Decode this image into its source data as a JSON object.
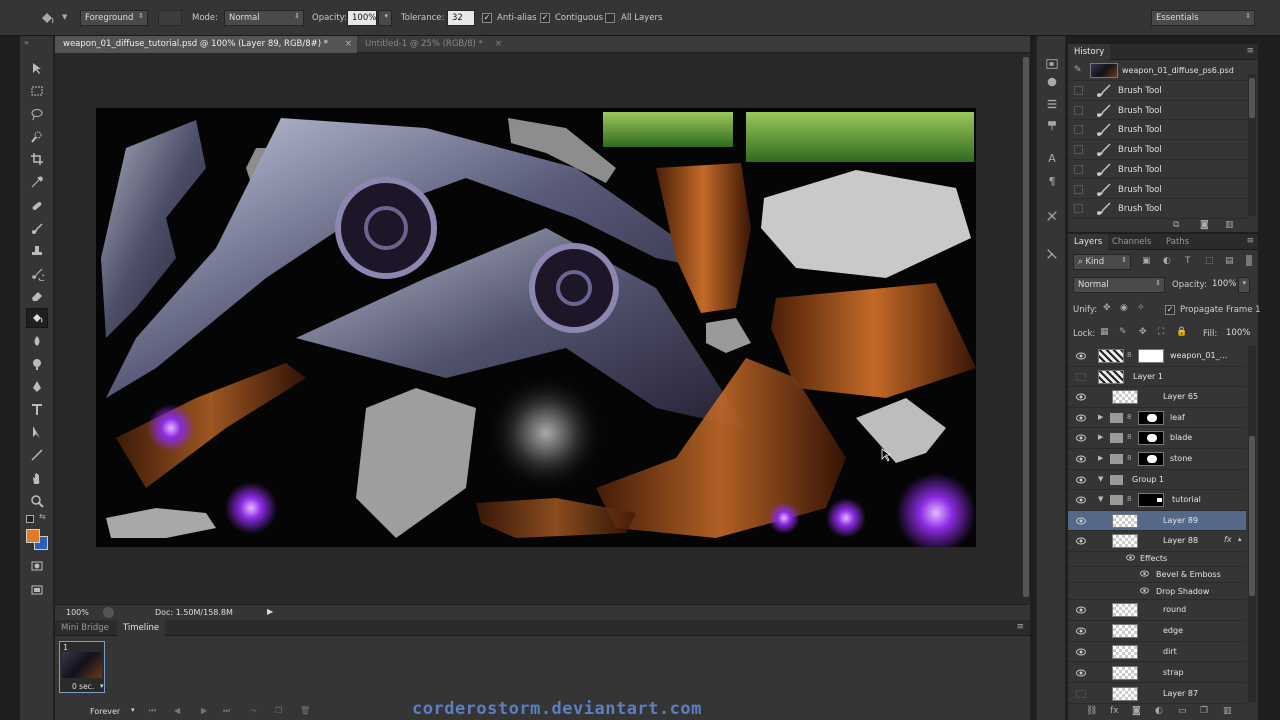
{
  "options_bar": {
    "preset": "Foreground",
    "mode_label": "Mode:",
    "mode_value": "Normal",
    "opacity_label": "Opacity:",
    "opacity_value": "100%",
    "tolerance_label": "Tolerance:",
    "tolerance_value": "32",
    "anti_alias_label": "Anti-alias",
    "contiguous_label": "Contiguous",
    "all_layers_label": "All Layers",
    "workspace": "Essentials"
  },
  "doc_tabs": [
    {
      "label": "weapon_01_diffuse_tutorial.psd @ 100% (Layer 89, RGB/8#) *"
    },
    {
      "label": "Untitled-1 @ 25% (RGB/8) *"
    }
  ],
  "status": {
    "zoom": "100%",
    "doc_size": "Doc: 1.50M/158.8M"
  },
  "bottom_panel": {
    "tabs": [
      "Mini Bridge",
      "Timeline"
    ],
    "frame_number": "1",
    "frame_delay": "0 sec.",
    "loop": "Forever"
  },
  "history": {
    "title": "History",
    "snapshot": "weapon_01_diffuse_ps6.psd",
    "items": [
      "Brush Tool",
      "Brush Tool",
      "Brush Tool",
      "Brush Tool",
      "Brush Tool",
      "Brush Tool",
      "Brush Tool"
    ]
  },
  "layers": {
    "tabs": [
      "Layers",
      "Channels",
      "Paths"
    ],
    "filter_kind": "Kind",
    "blend_mode": "Normal",
    "opacity_label": "Opacity:",
    "opacity_value": "100%",
    "unify_label": "Unify:",
    "propagate_label": "Propagate Frame 1",
    "lock_label": "Lock:",
    "fill_label": "Fill:",
    "fill_value": "100%",
    "rows": [
      {
        "name": "weapon_01_...",
        "kind": "masked",
        "visible": true
      },
      {
        "name": "Layer 1",
        "kind": "image",
        "visible": false
      },
      {
        "name": "Layer 65",
        "kind": "layer",
        "visible": true
      },
      {
        "name": "leaf",
        "kind": "group-masked",
        "visible": true
      },
      {
        "name": "blade",
        "kind": "group-masked",
        "visible": true
      },
      {
        "name": "stone",
        "kind": "group-masked",
        "visible": true
      },
      {
        "name": "Group 1",
        "kind": "group-open",
        "visible": true
      },
      {
        "name": "tutorial",
        "kind": "group-open-masked",
        "visible": true
      },
      {
        "name": "Layer 89",
        "kind": "layer",
        "visible": true,
        "selected": true
      },
      {
        "name": "Layer 88",
        "kind": "layer-fx",
        "visible": true
      },
      {
        "name": "Effects",
        "kind": "effects",
        "visible": true
      },
      {
        "name": "Bevel & Emboss",
        "kind": "effect",
        "visible": true
      },
      {
        "name": "Drop Shadow",
        "kind": "effect",
        "visible": true
      },
      {
        "name": "round",
        "kind": "layer",
        "visible": true
      },
      {
        "name": "edge",
        "kind": "layer",
        "visible": true
      },
      {
        "name": "dirt",
        "kind": "layer",
        "visible": true
      },
      {
        "name": "strap",
        "kind": "layer",
        "visible": true
      },
      {
        "name": "Layer 87",
        "kind": "layer",
        "visible": false
      }
    ]
  },
  "colors": {
    "foreground": "#e07a26",
    "background": "#2b5fb8",
    "accent_selected": "#54688a"
  },
  "watermark": "corderostorm.deviantart.com"
}
